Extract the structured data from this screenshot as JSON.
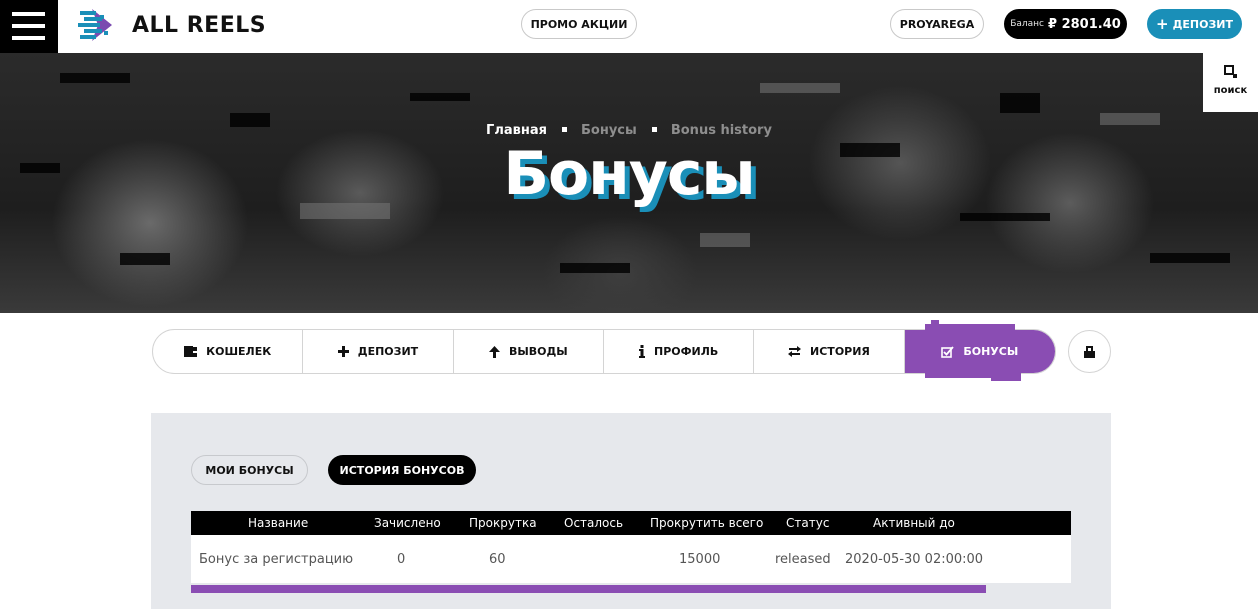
{
  "header": {
    "menu_icon": "hamburger-menu-icon",
    "logo_text": "ALL REELS",
    "promo_label": "ПРОМО АКЦИИ",
    "username": "PROYAREGA",
    "balance_label": "Баланс",
    "balance_value": "₽ 2801.40",
    "deposit_label": "ДЕПОЗИТ",
    "search_label": "поиск"
  },
  "hero": {
    "breadcrumb": [
      "Главная",
      "Бонусы",
      "Bonus history"
    ],
    "title": "Бонусы"
  },
  "account_tabs": [
    {
      "label": "КОШЕЛЕК",
      "icon": "wallet-icon"
    },
    {
      "label": "ДЕПОЗИТ",
      "icon": "plus-icon"
    },
    {
      "label": "ВЫВОДЫ",
      "icon": "arrow-up-icon"
    },
    {
      "label": "ПРОФИЛЬ",
      "icon": "info-icon"
    },
    {
      "label": "ИСТОРИЯ",
      "icon": "swap-arrows-icon"
    },
    {
      "label": "БОНУСЫ",
      "icon": "checkbox-icon",
      "active": true
    }
  ],
  "lock_icon": "lock-icon",
  "bonus_tabs": {
    "my_bonuses": "МОИ БОНУСЫ",
    "bonus_history": "ИСТОРИЯ БОНУСОВ"
  },
  "table": {
    "headers": [
      "Название",
      "Зачислено",
      "Прокрутка",
      "Осталось",
      "Прокрутить всего",
      "Статус",
      "Активный до"
    ],
    "rows": [
      [
        "Бонус за регистрацию",
        "0",
        "60",
        "",
        "15000",
        "released",
        "2020-05-30 02:00:00"
      ]
    ]
  },
  "colors": {
    "accent_blue": "#1a8fb8",
    "accent_purple": "#8a4db3",
    "panel_bg": "#e6e8ec"
  }
}
